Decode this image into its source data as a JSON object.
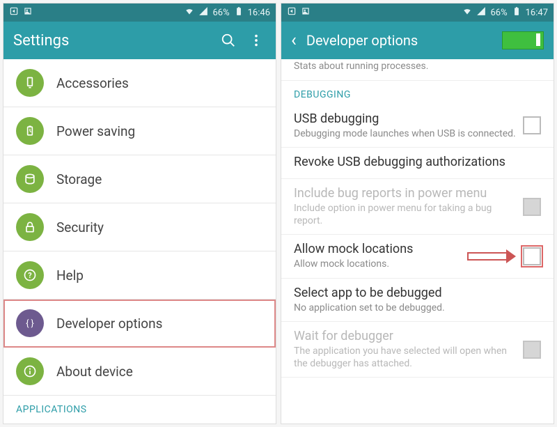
{
  "left": {
    "status": {
      "battery": "66%",
      "time": "16:46"
    },
    "appbar": {
      "title": "Settings"
    },
    "items": [
      {
        "label": "Accessories",
        "icon": "accessories",
        "color": "green"
      },
      {
        "label": "Power saving",
        "icon": "power",
        "color": "green"
      },
      {
        "label": "Storage",
        "icon": "storage",
        "color": "green"
      },
      {
        "label": "Security",
        "icon": "security",
        "color": "green"
      },
      {
        "label": "Help",
        "icon": "help",
        "color": "green"
      },
      {
        "label": "Developer options",
        "icon": "devopts",
        "color": "purple",
        "highlight": true
      },
      {
        "label": "About device",
        "icon": "about",
        "color": "green"
      }
    ],
    "section_footer": "APPLICATIONS"
  },
  "right": {
    "status": {
      "battery": "66%",
      "time": "16:47"
    },
    "appbar": {
      "title": "Developer options",
      "toggle_on": true
    },
    "partial_top": {
      "sub": "Stats about running processes."
    },
    "section_debugging": "DEBUGGING",
    "rows": [
      {
        "title": "USB debugging",
        "sub": "Debugging mode launches when USB is connected.",
        "checkbox": true,
        "disabled": false
      },
      {
        "title": "Revoke USB debugging authorizations",
        "sub": "",
        "checkbox": false,
        "disabled": false
      },
      {
        "title": "Include bug reports in power menu",
        "sub": "Include option in power menu for taking a bug report.",
        "checkbox": true,
        "disabled": true
      },
      {
        "title": "Allow mock locations",
        "sub": "Allow mock locations.",
        "checkbox": true,
        "disabled": false,
        "pointed": true
      },
      {
        "title": "Select app to be debugged",
        "sub": "No application set to be debugged.",
        "checkbox": false,
        "disabled": false
      },
      {
        "title": "Wait for debugger",
        "sub": "The application you have selected will open when the debugger has attached.",
        "checkbox": true,
        "disabled": true
      }
    ]
  }
}
